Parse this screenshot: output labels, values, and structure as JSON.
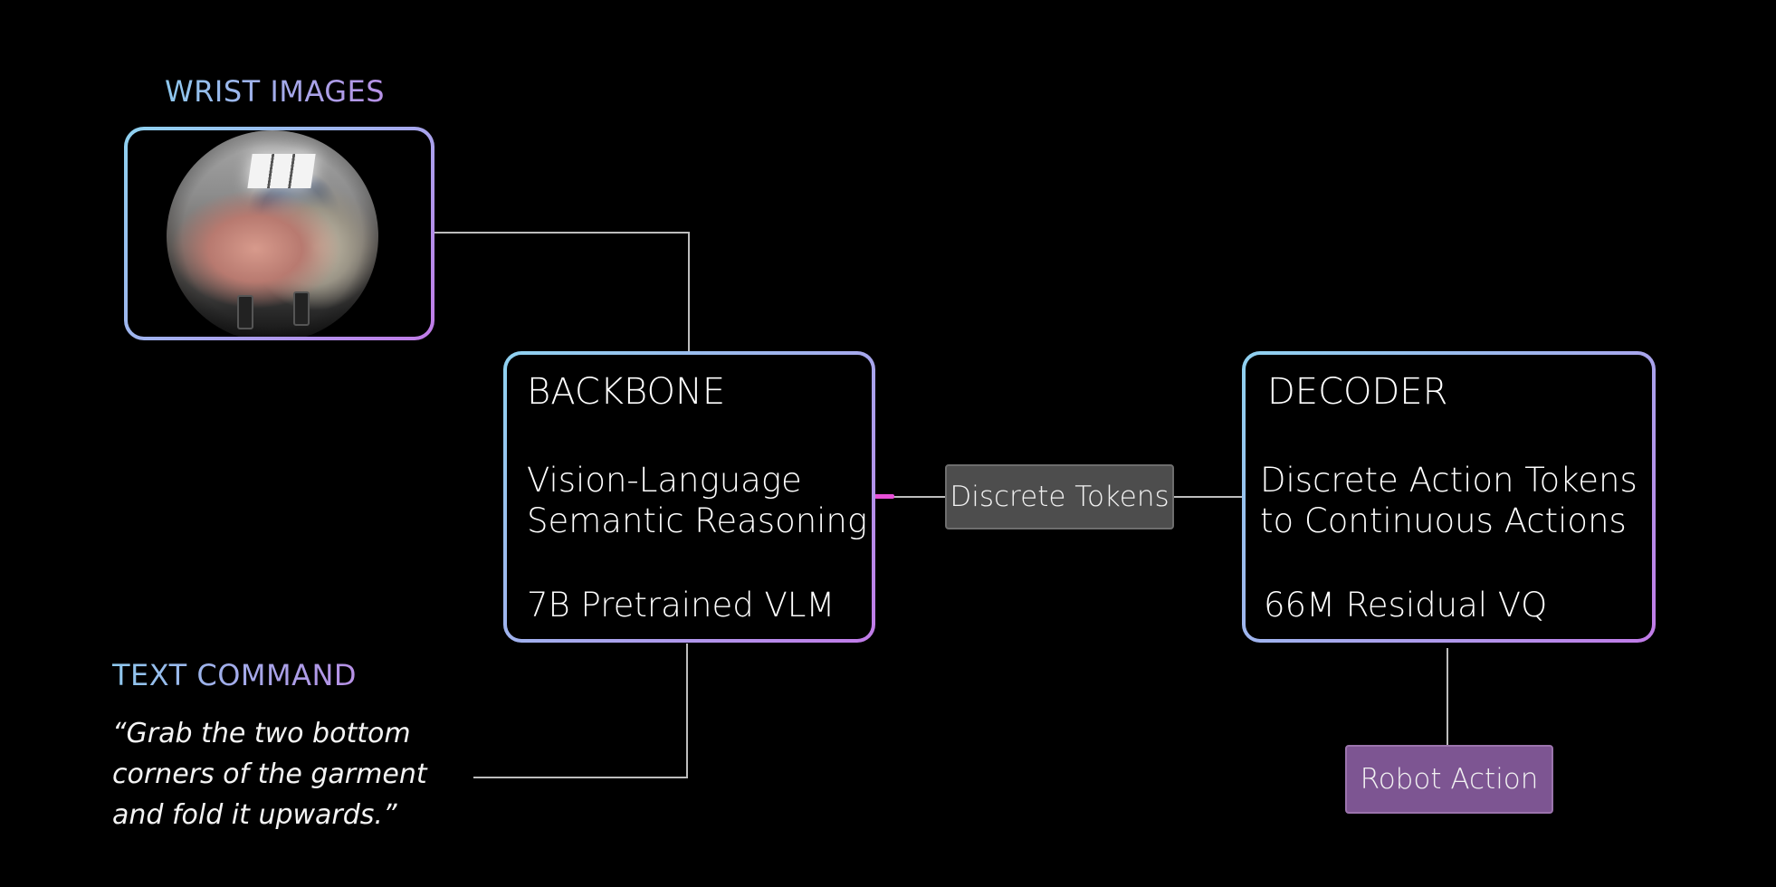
{
  "wrist_section": {
    "label": "WRIST IMAGES"
  },
  "text_command_section": {
    "label": "TEXT COMMAND",
    "command": "“Grab the two bottom corners of the garment and fold it upwards.”"
  },
  "backbone": {
    "title": "BACKBONE",
    "description_line1": "Vision-Language",
    "description_line2": "Semantic Reasoning",
    "model": "7B Pretrained VLM"
  },
  "connector": {
    "label": "Discrete Tokens"
  },
  "decoder": {
    "title": "DECODER",
    "description_line1": "Discrete Action Tokens",
    "description_line2": "to Continuous Actions",
    "model": "66M Residual VQ"
  },
  "output": {
    "label": "Robot Action"
  },
  "colors": {
    "border_gradient_start": "#8fd2f0",
    "border_gradient_end": "#c17ae8",
    "connector_fill": "#4d4d4d",
    "output_fill": "#7d5592",
    "line_color": "#bdbdbd",
    "accent_tick": "#e84fd8"
  }
}
